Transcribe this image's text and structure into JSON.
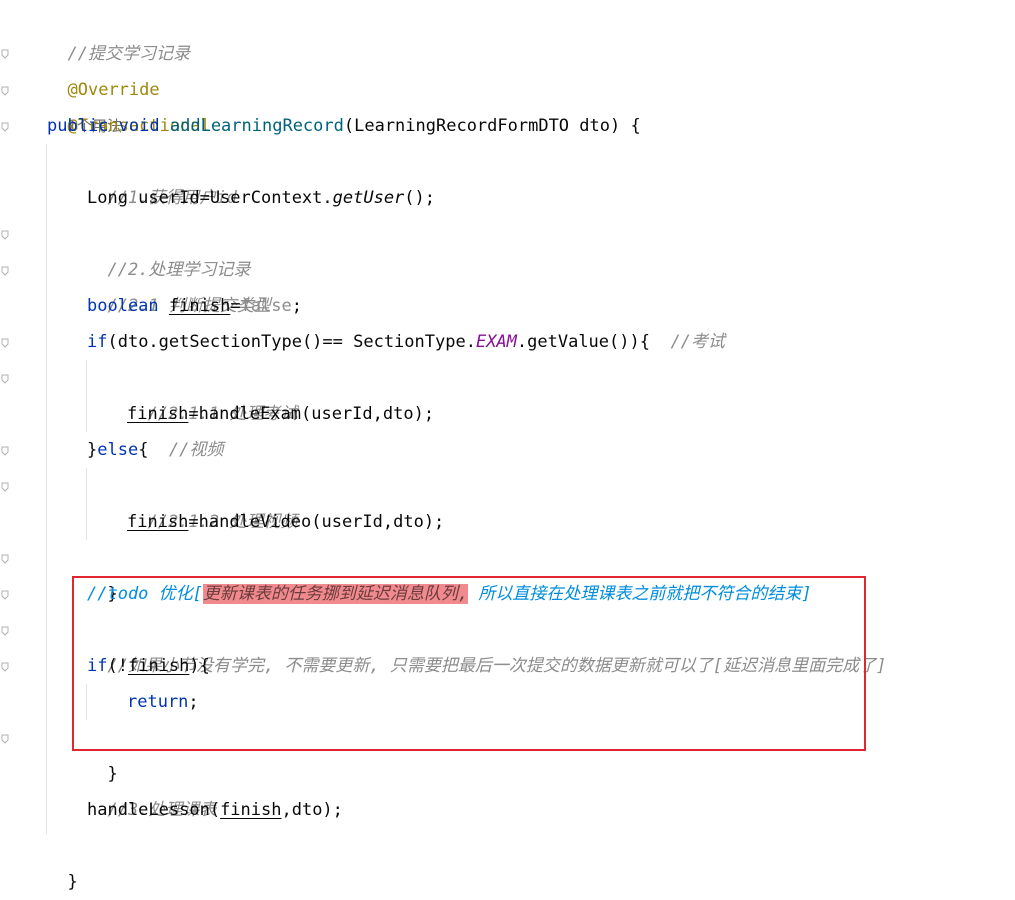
{
  "code": {
    "l1_comment": "//提交学习记录",
    "l2_annotation": "@Override",
    "l2_usage": "1个用法",
    "l3_annotation": "@Transactional",
    "l4_public": "public",
    "l4_void": "void",
    "l4_method": "addLearningRecord",
    "l4_params": "(LearningRecordFormDTO dto) {",
    "l5_comment": "//1.获得用户id",
    "l6_a": "Long userId=UserContext.",
    "l6_b": "getUser",
    "l6_c": "();",
    "l7_comment": "//2.处理学习记录",
    "l8_comment": "//2.1 判断提交类型",
    "l9_boolean": "boolean",
    "l9_finish": "finish",
    "l9_eq": "=",
    "l9_false": "false",
    "l9_end": ";",
    "l10_if": "if",
    "l10_a": "(dto.getSectionType()== SectionType.",
    "l10_exam": "EXAM",
    "l10_b": ".getValue()){  ",
    "l10_comment": "//考试",
    "l11_comment": "//2.1.1 处理考试",
    "l12_finish": "finish",
    "l12_rest": "=handleExam(userId,dto);",
    "l13_brace": "}",
    "l13_else": "else",
    "l13_brace2": "{  ",
    "l13_comment": "//视频",
    "l14_comment": "//2.1.2 处理视频",
    "l15_finish": "finish",
    "l15_rest": "=handleVideo(userId,dto);",
    "l16_brace": "}",
    "l17_a": "//todo 优化[",
    "l17_hl": "更新课表的任务挪到延迟消息队列,",
    "l17_b": " 所以直接在处理课表之前就把不符合的结束]",
    "l18_comment": "//如果小节没有学完, 不需要更新, 只需要把最后一次提交的数据更新就可以了[延迟消息里面完成了]",
    "l19_if": "if",
    "l19_a": "(!",
    "l19_finish": "finish",
    "l19_b": "){",
    "l20_return": "return",
    "l20_end": ";",
    "l21_brace": "}",
    "l22_comment": "//3.处理课表",
    "l23_a": "handleLesson(",
    "l23_finish": "finish",
    "l23_b": ",dto);",
    "l24_brace": "}"
  },
  "colors": {
    "keyword": "#0033b3",
    "comment": "#8c8c8c",
    "todo": "#008dde",
    "annotation": "#9e880d",
    "highlight": "#f08a8e",
    "box": "#e0262f"
  }
}
